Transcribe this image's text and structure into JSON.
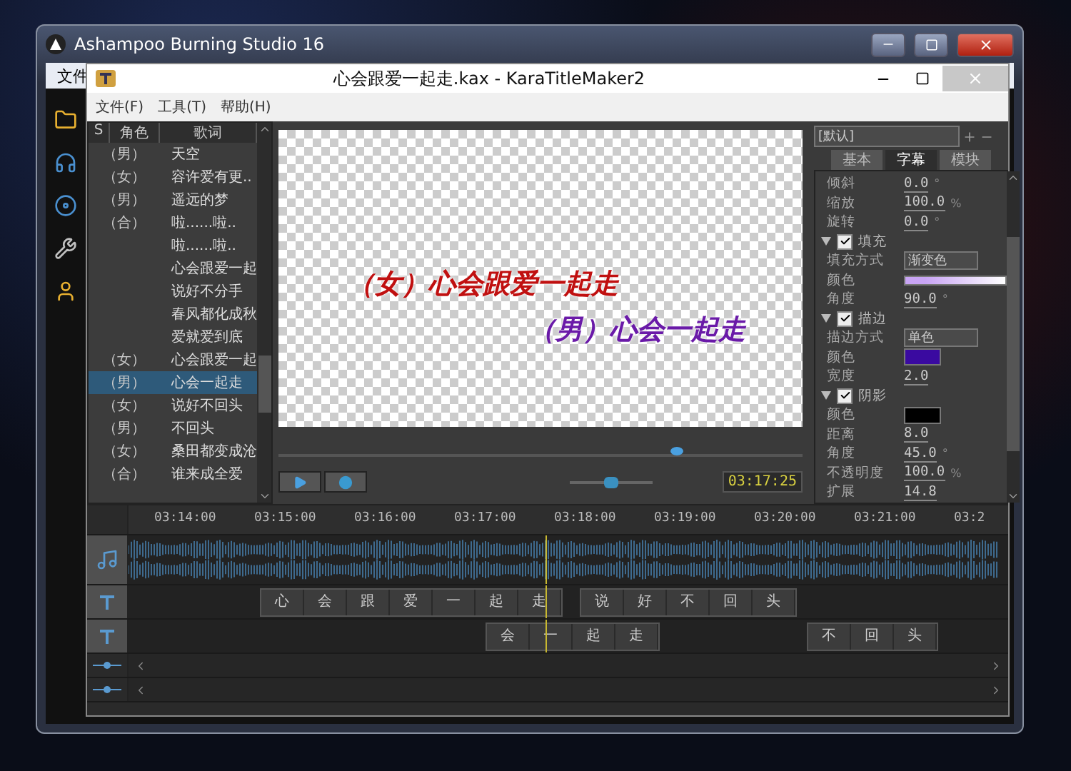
{
  "outer_window": {
    "title": "Ashampoo Burning Studio 16",
    "menu_label": "文件"
  },
  "window": {
    "title": "心会跟爱一起走.kax - KaraTitleMaker2",
    "menu": [
      "文件(F)",
      "工具(T)",
      "帮助(H)"
    ]
  },
  "lyrics": {
    "columns": [
      "S",
      "角色",
      "歌词"
    ],
    "rows": [
      {
        "role": "（男）",
        "text": "天空",
        "selected": false
      },
      {
        "role": "（女）",
        "text": "容许爱有更..",
        "selected": false
      },
      {
        "role": "（男）",
        "text": "遥远的梦",
        "selected": false
      },
      {
        "role": "（合）",
        "text": "啦......啦..",
        "selected": false
      },
      {
        "role": "",
        "text": "啦......啦..",
        "selected": false
      },
      {
        "role": "",
        "text": "心会跟爱一起",
        "selected": false
      },
      {
        "role": "",
        "text": "说好不分手",
        "selected": false
      },
      {
        "role": "",
        "text": "春风都化成秋",
        "selected": false
      },
      {
        "role": "",
        "text": "爱就爱到底",
        "selected": false
      },
      {
        "role": "（女）",
        "text": "心会跟爱一起",
        "selected": false
      },
      {
        "role": "（男）",
        "text": "心会一起走",
        "selected": true
      },
      {
        "role": "（女）",
        "text": "说好不回头",
        "selected": false
      },
      {
        "role": "（男）",
        "text": "不回头",
        "selected": false
      },
      {
        "role": "（女）",
        "text": "桑田都变成沧",
        "selected": false
      },
      {
        "role": "（合）",
        "text": "谁来成全爱",
        "selected": false
      }
    ]
  },
  "preview": {
    "lines": [
      {
        "text": "（女）心会跟爱一起走",
        "color": "#c01010"
      },
      {
        "text": "（男）心会一起走",
        "color": "#6a1aa8"
      }
    ],
    "seek": {
      "level": 0.76
    },
    "zoom": {
      "level": 0.5
    },
    "time": "03:17:25"
  },
  "properties": {
    "preset": "[默认]",
    "tabs": [
      {
        "label": "基本",
        "selected": false
      },
      {
        "label": "字幕",
        "selected": true
      },
      {
        "label": "模块",
        "selected": false
      }
    ],
    "items": [
      {
        "kind": "field",
        "label": "倾斜",
        "value": "0.0",
        "unit": "°"
      },
      {
        "kind": "field",
        "label": "缩放",
        "value": "100.0",
        "unit": "%"
      },
      {
        "kind": "field",
        "label": "旋转",
        "value": "0.0",
        "unit": "°"
      },
      {
        "kind": "section",
        "label": "填充",
        "checked": true
      },
      {
        "kind": "select",
        "label": "填充方式",
        "value": "渐变色"
      },
      {
        "kind": "gradient",
        "label": "颜色",
        "color": "#c8a4f4"
      },
      {
        "kind": "field",
        "label": "角度",
        "value": "90.0",
        "unit": "°"
      },
      {
        "kind": "section",
        "label": "描边",
        "checked": true
      },
      {
        "kind": "select",
        "label": "描边方式",
        "value": "单色"
      },
      {
        "kind": "swatch",
        "label": "颜色",
        "color": "#3a0aa0"
      },
      {
        "kind": "field",
        "label": "宽度",
        "value": "2.0"
      },
      {
        "kind": "section",
        "label": "阴影",
        "checked": true
      },
      {
        "kind": "swatch",
        "label": "颜色",
        "color": "#000000"
      },
      {
        "kind": "field",
        "label": "距离",
        "value": "8.0"
      },
      {
        "kind": "field",
        "label": "角度",
        "value": "45.0",
        "unit": "°"
      },
      {
        "kind": "field",
        "label": "不透明度",
        "value": "100.0",
        "unit": "%"
      },
      {
        "kind": "field",
        "label": "扩展",
        "value": "14.8"
      }
    ]
  },
  "timeline": {
    "ticks": [
      "03:14:00",
      "03:15:00",
      "03:16:00",
      "03:17:00",
      "03:18:00",
      "03:19:00",
      "03:20:00",
      "03:21:00",
      "03:2"
    ],
    "tracks": [
      {
        "blocks": [
          [
            "心",
            "会",
            "跟",
            "爱",
            "一",
            "起",
            "走"
          ],
          [
            "说",
            "好",
            "不",
            "回",
            "头"
          ]
        ]
      },
      {
        "blocks": [
          [
            "会",
            "一",
            "起",
            "走"
          ],
          [
            "不",
            "回",
            "头"
          ]
        ]
      }
    ]
  }
}
